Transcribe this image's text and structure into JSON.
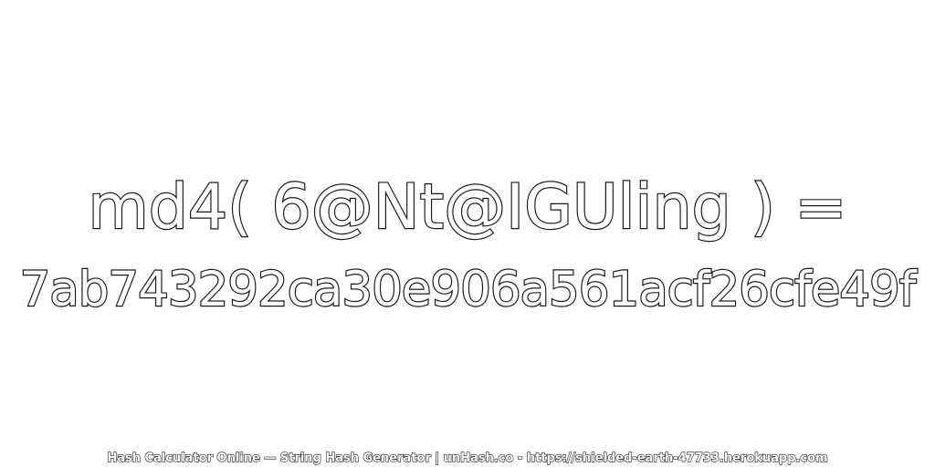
{
  "heading": {
    "expression": "md4( 6@Nt@IGUling ) ="
  },
  "result": {
    "hash": "7ab743292ca30e906a561acf26cfe49f"
  },
  "footer": {
    "credit": "Hash Calculator Online — String Hash Generator | unHash.co - https://shielded-earth-47733.herokuapp.com"
  },
  "colors": {
    "background": "#ffffff",
    "outline": "#1a1a1a",
    "fill": "#ffffff"
  }
}
